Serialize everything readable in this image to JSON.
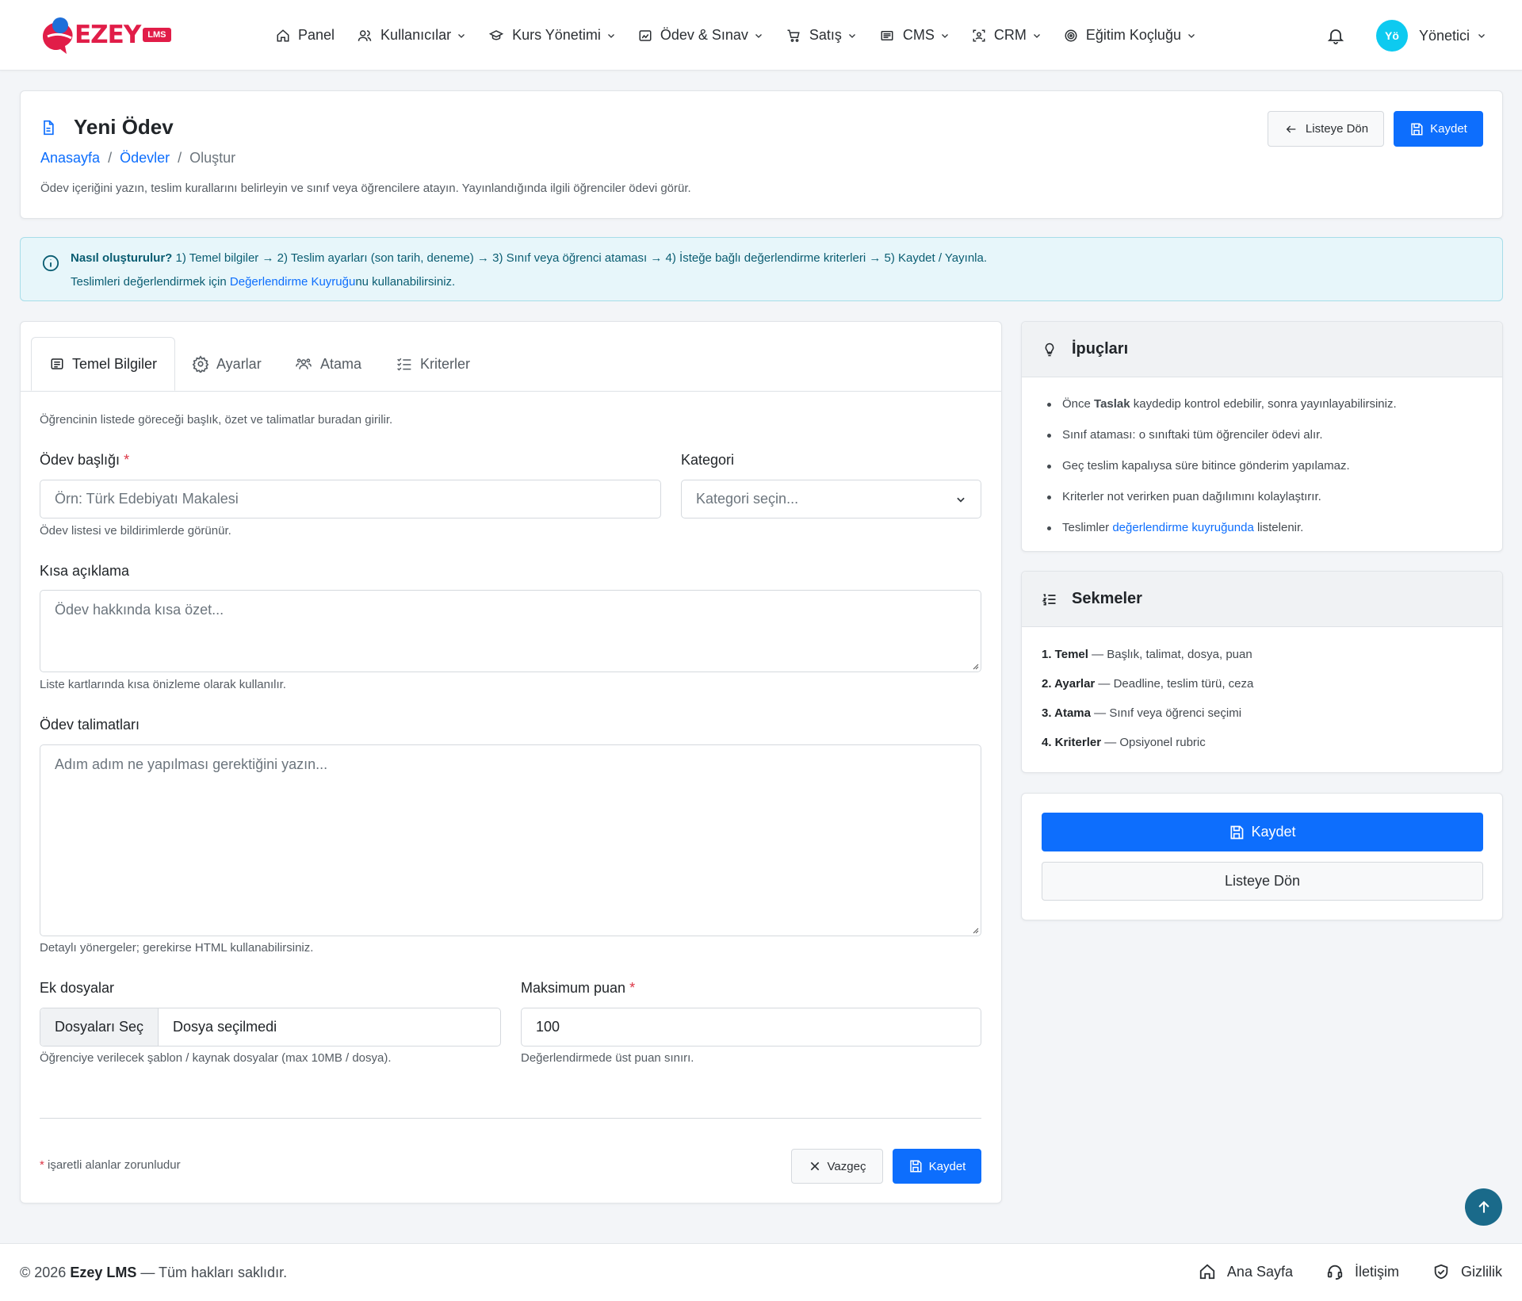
{
  "brand": {
    "name": "EZEY",
    "badge": "LMS"
  },
  "nav": {
    "items": [
      {
        "label": "Panel",
        "icon": "home-icon",
        "dropdown": false
      },
      {
        "label": "Kullanıcılar",
        "icon": "users-icon",
        "dropdown": true
      },
      {
        "label": "Kurs Yönetimi",
        "icon": "graduation-cap-icon",
        "dropdown": true
      },
      {
        "label": "Ödev & Sınav",
        "icon": "clipboard-chart-icon",
        "dropdown": true
      },
      {
        "label": "Satış",
        "icon": "cart-icon",
        "dropdown": true
      },
      {
        "label": "CMS",
        "icon": "layout-icon",
        "dropdown": true
      },
      {
        "label": "CRM",
        "icon": "scan-user-icon",
        "dropdown": true
      },
      {
        "label": "Eğitim Koçluğu",
        "icon": "target-icon",
        "dropdown": true
      }
    ],
    "user": {
      "initials": "Yö",
      "name": "Yönetici"
    }
  },
  "header": {
    "title": "Yeni Ödev",
    "breadcrumb": [
      "Anasayfa",
      "Ödevler",
      "Oluştur"
    ],
    "description": "Ödev içeriğini yazın, teslim kurallarını belirleyin ve sınıf veya öğrencilere atayın. Yayınlandığında ilgili öğrenciler ödevi görür.",
    "back_label": "Listeye Dön",
    "save_label": "Kaydet"
  },
  "info": {
    "bold": "Nasıl oluşturulur?",
    "steps": " 1) Temel bilgiler → 2) Teslim ayarları (son tarih, deneme) → 3) Sınıf veya öğrenci ataması → 4) İsteğe bağlı değerlendirme kriterleri → 5) Kaydet / Yayınla.",
    "line2_pre": "Teslimleri değerlendirmek için ",
    "line2_link": "Değerlendirme Kuyruğu",
    "line2_post": "nu kullanabilirsiniz."
  },
  "tabs": [
    {
      "label": "Temel Bilgiler",
      "icon": "list-box-icon",
      "active": true
    },
    {
      "label": "Ayarlar",
      "icon": "gear-icon",
      "active": false
    },
    {
      "label": "Atama",
      "icon": "people-icon",
      "active": false
    },
    {
      "label": "Kriterler",
      "icon": "checklist-icon",
      "active": false
    }
  ],
  "form": {
    "intro": "Öğrencinin listede göreceği başlık, özet ve talimatlar buradan girilir.",
    "title": {
      "label": "Ödev başlığı",
      "required": "*",
      "placeholder": "Örn: Türk Edebiyatı Makalesi",
      "help": "Ödev listesi ve bildirimlerde görünür."
    },
    "category": {
      "label": "Kategori",
      "placeholder": "Kategori seçin..."
    },
    "summary": {
      "label": "Kısa açıklama",
      "placeholder": "Ödev hakkında kısa özet...",
      "help": "Liste kartlarında kısa önizleme olarak kullanılır."
    },
    "instructions": {
      "label": "Ödev talimatları",
      "placeholder": "Adım adım ne yapılması gerektiğini yazın...",
      "help": "Detaylı yönergeler; gerekirse HTML kullanabilirsiniz."
    },
    "files": {
      "label": "Ek dosyalar",
      "button": "Dosyaları Seç",
      "value": "Dosya seçilmedi",
      "help": "Öğrenciye verilecek şablon / kaynak dosyalar (max 10MB / dosya)."
    },
    "max_score": {
      "label": "Maksimum puan",
      "required": "*",
      "value": "100",
      "help": "Değerlendirmede üst puan sınırı."
    },
    "required_note_star": "*",
    "required_note": " işaretli alanlar zorunludur",
    "cancel_label": "Vazgeç",
    "save_label": "Kaydet"
  },
  "tips": {
    "title": "İpuçları",
    "items": [
      {
        "pre": "Önce ",
        "bold": "Taslak",
        "post": " kaydedip kontrol edebilir, sonra yayınlayabilirsiniz."
      },
      {
        "text": "Sınıf ataması: o sınıftaki tüm öğrenciler ödevi alır."
      },
      {
        "text": "Geç teslim kapalıysa süre bitince gönderim yapılamaz."
      },
      {
        "text": "Kriterler not verirken puan dağılımını kolaylaştırır."
      },
      {
        "pre": "Teslimler ",
        "link": "değerlendirme kuyruğunda",
        "post": " listelenir."
      }
    ]
  },
  "sections": {
    "title": "Sekmeler",
    "items": [
      {
        "bold": "1. Temel",
        "text": " — Başlık, talimat, dosya, puan"
      },
      {
        "bold": "2. Ayarlar",
        "text": " — Deadline, teslim türü, ceza"
      },
      {
        "bold": "3. Atama",
        "text": " — Sınıf veya öğrenci seçimi"
      },
      {
        "bold": "4. Kriterler",
        "text": " — Opsiyonel rubric"
      }
    ]
  },
  "side_actions": {
    "save_label": "Kaydet",
    "back_label": "Listeye Dön"
  },
  "footer": {
    "copyright_pre": "© 2026 ",
    "copyright_brand": "Ezey LMS",
    "copyright_post": " — Tüm hakları saklıdır.",
    "links": [
      {
        "label": "Ana Sayfa",
        "icon": "home-icon"
      },
      {
        "label": "İletişim",
        "icon": "headset-icon"
      },
      {
        "label": "Gizlilik",
        "icon": "shield-icon"
      }
    ]
  },
  "colors": {
    "primary": "#0d6efd",
    "brand": "#e11d48",
    "info_bg": "#e7f6fa",
    "avatar": "#0dcaf0",
    "scroll_top": "#1a6a8a"
  }
}
